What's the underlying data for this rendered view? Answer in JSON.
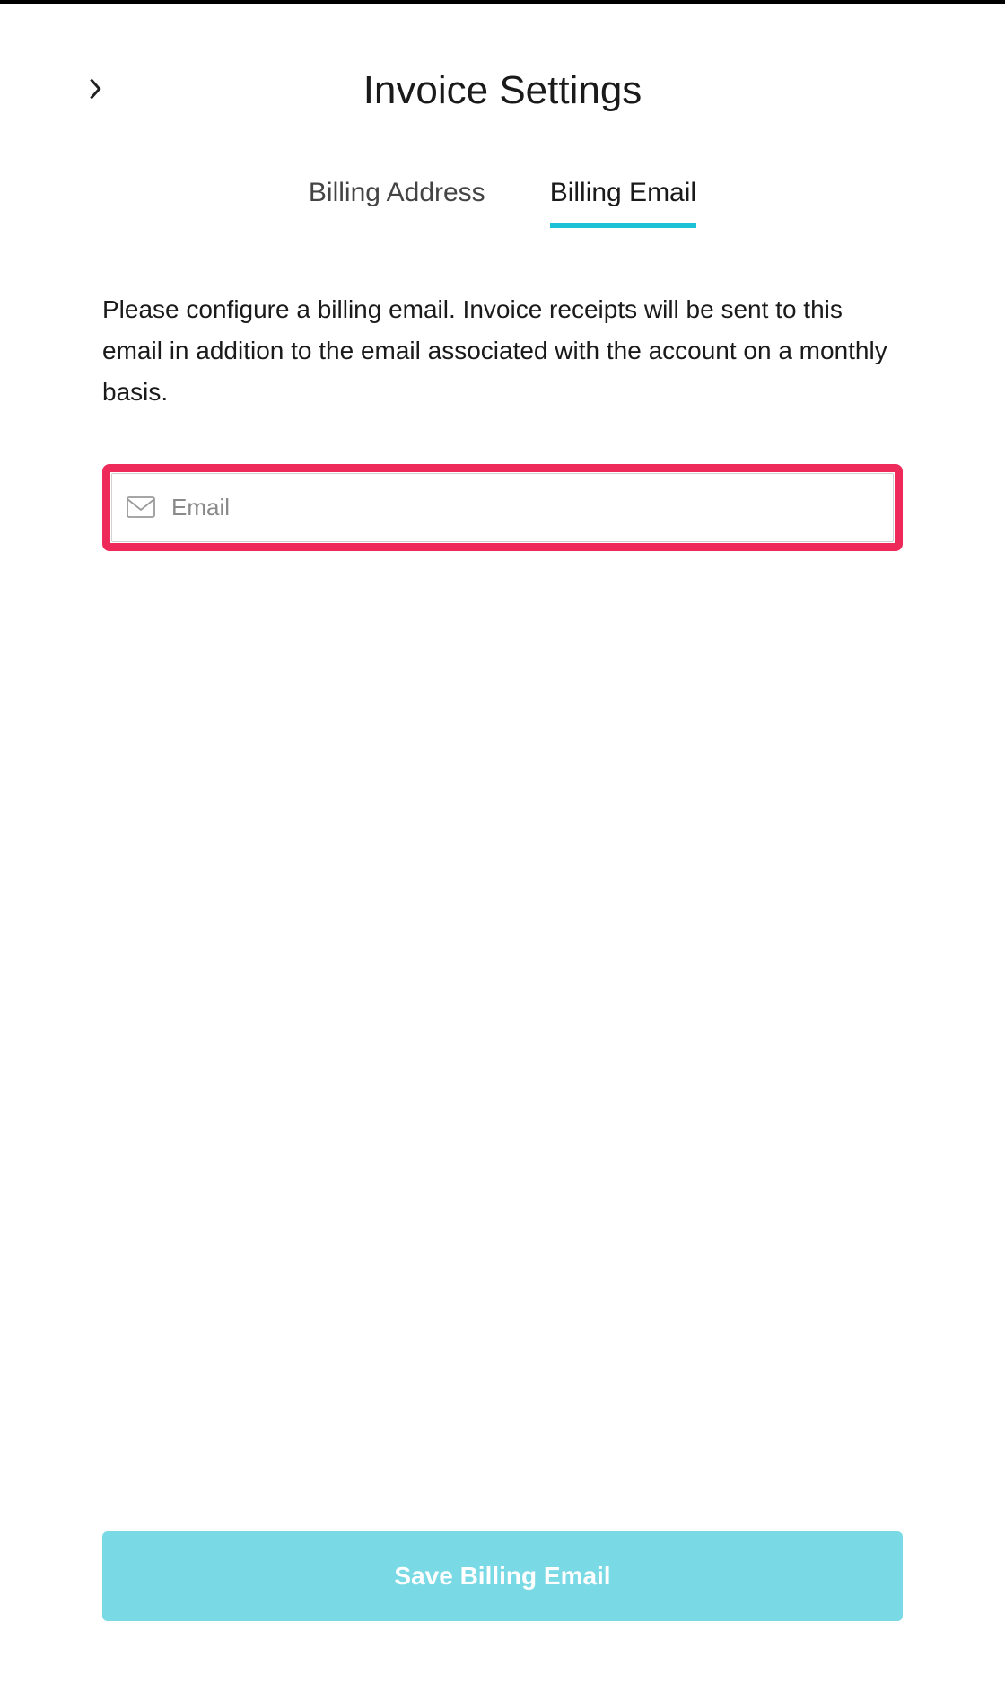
{
  "header": {
    "title": "Invoice Settings"
  },
  "tabs": {
    "billing_address": "Billing Address",
    "billing_email": "Billing Email",
    "active": "billing_email"
  },
  "main": {
    "description": "Please configure a billing email. Invoice receipts will be sent to this email in addition to the email associated with the account on a monthly basis.",
    "email_placeholder": "Email",
    "email_value": ""
  },
  "actions": {
    "save_label": "Save Billing Email"
  },
  "colors": {
    "accent_underline": "#1cc1d6",
    "highlight_border": "#ee2a5b",
    "save_button_bg": "#79d9e4"
  }
}
